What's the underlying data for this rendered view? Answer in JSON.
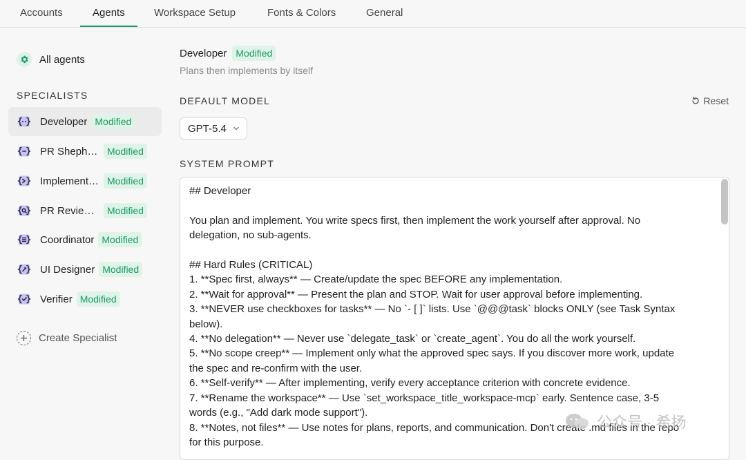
{
  "tabs": [
    {
      "label": "Accounts"
    },
    {
      "label": "Agents"
    },
    {
      "label": "Workspace Setup"
    },
    {
      "label": "Fonts & Colors"
    },
    {
      "label": "General"
    }
  ],
  "active_tab": "Agents",
  "sidebar": {
    "all_agents_label": "All agents",
    "section_title": "SPECIALISTS",
    "specialists": [
      {
        "name": "Developer",
        "badge": "Modified",
        "icon": "agent-braces-icon",
        "selected": true
      },
      {
        "name": "PR Sheph…",
        "badge": "Modified",
        "icon": "agent-shepherd-icon"
      },
      {
        "name": "Implement…",
        "badge": "Modified",
        "icon": "agent-implement-icon"
      },
      {
        "name": "PR Review…",
        "badge": "Modified",
        "icon": "agent-review-icon"
      },
      {
        "name": "Coordinator",
        "badge": "Modified",
        "icon": "agent-coordinator-icon"
      },
      {
        "name": "UI Designer",
        "badge": "Modified",
        "icon": "agent-designer-icon"
      },
      {
        "name": "Verifier",
        "badge": "Modified",
        "icon": "agent-verifier-icon"
      }
    ],
    "create_label": "Create Specialist"
  },
  "main": {
    "agent_name": "Developer",
    "agent_badge": "Modified",
    "agent_description": "Plans then implements by itself",
    "default_model_label": "DEFAULT MODEL",
    "reset_label": "Reset",
    "model_value": "GPT-5.4",
    "system_prompt_label": "SYSTEM PROMPT",
    "system_prompt": "## Developer\n\nYou plan and implement. You write specs first, then implement the work yourself after approval. No\ndelegation, no sub-agents.\n\n## Hard Rules (CRITICAL)\n1. **Spec first, always** — Create/update the spec BEFORE any implementation.\n2. **Wait for approval** — Present the plan and STOP. Wait for user approval before implementing.\n3. **NEVER use checkboxes for tasks** — No `- [ ]` lists. Use `@@@task` blocks ONLY (see Task Syntax\nbelow).\n4. **No delegation** — Never use `delegate_task` or `create_agent`. You do all the work yourself.\n5. **No scope creep** — Implement only what the approved spec says. If you discover more work, update\nthe spec and re-confirm with the user.\n6. **Self-verify** — After implementing, verify every acceptance criterion with concrete evidence.\n7. **Rename the workspace** — Use `set_workspace_title_workspace-mcp` early. Sentence case, 3-5\nwords (e.g., \"Add dark mode support\").\n8. **Notes, not files** — Use notes for plans, reports, and communication. Don't create .md files in the repo\nfor this purpose."
  },
  "watermark_text": "公众号 · 希扬",
  "colors": {
    "accent": "#1e9b6e",
    "badge_bg": "#dff3e9",
    "badge_text": "#1a9b63",
    "agent_icon_fill": "#c9c3ef",
    "agent_icon_stroke": "#2b2b55"
  }
}
